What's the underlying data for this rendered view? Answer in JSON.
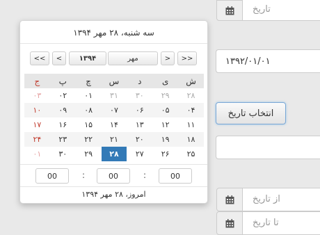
{
  "inputs": {
    "date_placeholder": "تاریخ",
    "date_value": "۱۳۹۲/۰۱/۰۱",
    "from_placeholder": "از تاریخ",
    "to_placeholder": "تا تاریخ"
  },
  "button": {
    "label": "انتخاب تاریخ"
  },
  "calendar": {
    "title": "سه شنبه، ۲۸ مهر ۱۳۹۴",
    "nav": {
      "prev_year": "<<",
      "prev_month": "<",
      "year": "۱۳۹۴",
      "month": "مهر",
      "next_month": ">",
      "next_year": ">>"
    },
    "weekdays": [
      "ج",
      "پ",
      "چ",
      "س",
      "د",
      "ی",
      "ش"
    ],
    "weeks": [
      [
        "۰۳",
        "۰۲",
        "۰۱",
        "۳۱",
        "۳۰",
        "۲۹",
        "۲۸"
      ],
      [
        "۱۰",
        "۰۹",
        "۰۸",
        "۰۷",
        "۰۶",
        "۰۵",
        "۰۴"
      ],
      [
        "۱۷",
        "۱۶",
        "۱۵",
        "۱۴",
        "۱۳",
        "۱۲",
        "۱۱"
      ],
      [
        "۲۴",
        "۲۳",
        "۲۲",
        "۲۱",
        "۲۰",
        "۱۹",
        "۱۸"
      ],
      [
        "۰۱",
        "۳۰",
        "۲۹",
        "۲۸",
        "۲۷",
        "۲۶",
        "۲۵"
      ]
    ],
    "time": {
      "hour": "00",
      "minute": "00",
      "second": "00",
      "separator": ":"
    },
    "today": "امروز، ۲۸ مهر ۱۳۹۴"
  },
  "colors": {
    "selected": "#337ab7",
    "friday": "#c0392b"
  },
  "icons": {
    "addon": "calendar-icon"
  }
}
